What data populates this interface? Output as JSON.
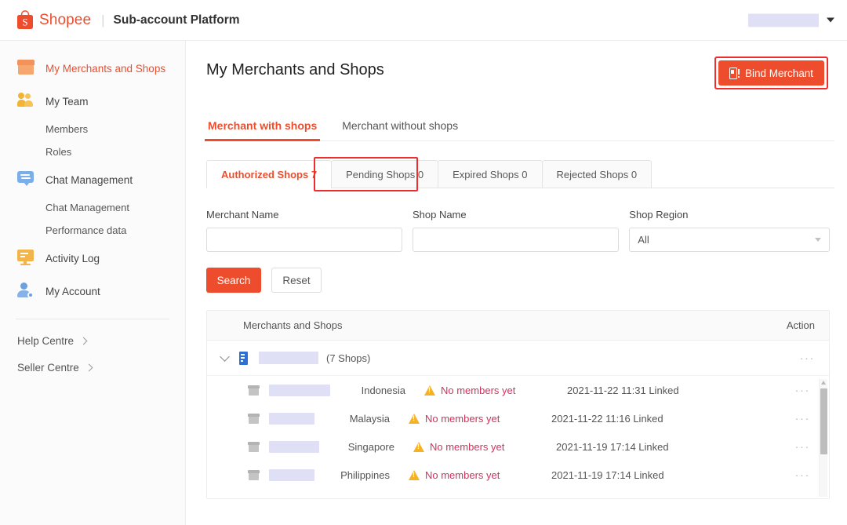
{
  "topbar": {
    "brand_name": "Shopee",
    "divider": "|",
    "subtitle": "Sub-account Platform",
    "account_redacted": "",
    "logo_letter": "S"
  },
  "sidebar": {
    "items": [
      {
        "label": "My Merchants and Shops",
        "icon": "storefront-icon",
        "active": true
      },
      {
        "label": "My Team",
        "icon": "people-icon",
        "active": false
      }
    ],
    "team_sub": [
      {
        "label": "Members"
      },
      {
        "label": "Roles"
      }
    ],
    "chat": {
      "label": "Chat Management",
      "icon": "chat-icon"
    },
    "chat_sub": [
      {
        "label": "Chat Management"
      },
      {
        "label": "Performance data"
      }
    ],
    "activity": {
      "label": "Activity Log",
      "icon": "monitor-icon"
    },
    "account": {
      "label": "My Account",
      "icon": "account-gear-icon"
    },
    "footer": [
      {
        "label": "Help Centre"
      },
      {
        "label": "Seller Centre"
      }
    ]
  },
  "main": {
    "page_title": "My Merchants and Shops",
    "bind_button": "Bind Merchant",
    "tabs": [
      {
        "label": "Merchant with shops",
        "active": true
      },
      {
        "label": "Merchant without shops",
        "active": false
      }
    ],
    "status_tabs": [
      {
        "label": "Authorized Shops 7",
        "active": true
      },
      {
        "label": "Pending Shops 0",
        "active": false,
        "highlighted": true
      },
      {
        "label": "Expired Shops 0",
        "active": false
      },
      {
        "label": "Rejected Shops 0",
        "active": false
      }
    ],
    "filters": {
      "merchant_name_label": "Merchant Name",
      "merchant_name_value": "",
      "shop_name_label": "Shop Name",
      "shop_name_value": "",
      "shop_region_label": "Shop Region",
      "shop_region_value": "All"
    },
    "buttons": {
      "search": "Search",
      "reset": "Reset"
    },
    "table": {
      "col_main": "Merchants and Shops",
      "col_action": "Action",
      "merchant": {
        "name_redacted": "",
        "shop_count": "(7 Shops)",
        "action_dots": "···"
      },
      "shops": [
        {
          "name_redacted": "",
          "redact_width": 78,
          "region": "Indonesia",
          "status": "No members yet",
          "date": "2021-11-22 11:31 Linked",
          "action_dots": "···"
        },
        {
          "name_redacted": "",
          "redact_width": 58,
          "region": "Malaysia",
          "status": "No members yet",
          "date": "2021-11-22 11:16 Linked",
          "action_dots": "···"
        },
        {
          "name_redacted": "",
          "redact_width": 64,
          "region": "Singapore",
          "status": "No members yet",
          "date": "2021-11-19 17:14 Linked",
          "action_dots": "···"
        },
        {
          "name_redacted": "",
          "redact_width": 58,
          "region": "Philippines",
          "status": "No members yet",
          "date": "2021-11-19 17:14 Linked",
          "action_dots": "···"
        }
      ]
    }
  },
  "colors": {
    "brand_orange": "#ee4d2d",
    "highlight_red": "#ee2d2d",
    "status_red": "#d0335c",
    "warning_amber": "#f5b324",
    "redact_blue": "#dfe0f5"
  }
}
